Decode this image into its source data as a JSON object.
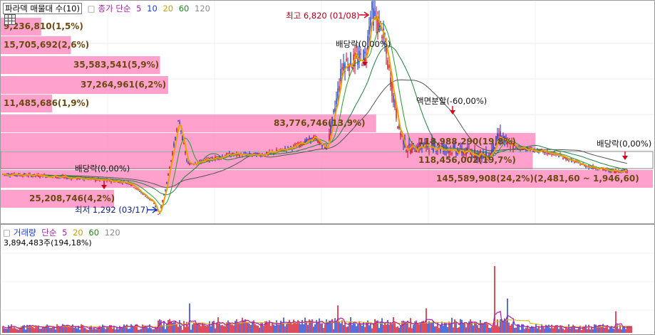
{
  "price_legend": {
    "label": "파라덱 매물대 수(10)",
    "ma_prefix": "종가 단순",
    "periods": [
      "5",
      "10",
      "20",
      "60",
      "120"
    ]
  },
  "volume_legend": {
    "label": "거래량",
    "ma_prefix": "단순",
    "periods": [
      "5",
      "20",
      "60",
      "120"
    ],
    "readout": "3,894,483주(194,18%)"
  },
  "colors": {
    "band": "#ff8fc4",
    "up": "#d0001c",
    "down": "#1030c8",
    "ma5": "#e8a000",
    "ma20": "#2a9a2a",
    "ma60": "#1f7f3f",
    "ma120": "#555555",
    "vol_ma5": "#b01ab0",
    "vol_ma20": "#d4b000"
  },
  "chart_data": {
    "type": "candlestick-with-volume-profile",
    "price_range_min": 1250,
    "price_range_max": 7000,
    "volume_bands": [
      {
        "label": "9,236,810(1,5%)",
        "percent": 1.5
      },
      {
        "label": "15,705,692(2,6%)",
        "percent": 2.6
      },
      {
        "label": "35,583,541(5,9%)",
        "percent": 5.9
      },
      {
        "label": "37,264,961(6,2%)",
        "percent": 6.2
      },
      {
        "label": "11,485,686(1,9%)",
        "percent": 1.9
      },
      {
        "label": "83,776,746(13,9%)",
        "percent": 13.9
      },
      {
        "label": "118,988,290(19,8%)",
        "percent": 19.8
      },
      {
        "label": "118,456,002(19,7%)",
        "percent": 19.7
      },
      {
        "label": "145,589,908(24,2%)(2,481,60 ~ 1,946,60)",
        "percent": 24.2
      },
      {
        "label": "25,208,746(4,2%)",
        "percent": 4.2
      }
    ],
    "annotations": {
      "high": "최고 6,820 (01/08)",
      "low": "최저 1,292 (03/17)",
      "dividend_1": "배당락(0,00%)",
      "dividend_2": "배당락(0,00%)",
      "dividend_3": "배당락(0,00%)",
      "split": "액면분할(-60,00%)"
    },
    "high_price": 6820,
    "low_price": 1292
  }
}
